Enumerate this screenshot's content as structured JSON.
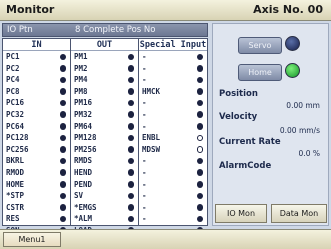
{
  "header": {
    "title": "Monitor",
    "axis_label": "Axis No. 00"
  },
  "pin_header": {
    "pin_label": "IO Ptn",
    "complete_label": "8 Complete Pos No"
  },
  "columns": {
    "in": "IN",
    "out": "OUT",
    "special": "Special Input"
  },
  "in_signals": [
    "PC1",
    "PC2",
    "PC4",
    "PC8",
    "PC16",
    "PC32",
    "PC64",
    "PC128",
    "PC256",
    "BKRL",
    "RMOD",
    "HOME",
    "*STP",
    "CSTR",
    "RES",
    "SON"
  ],
  "out_signals": [
    "PM1",
    "PM2",
    "PM4",
    "PM8",
    "PM16",
    "PM32",
    "PM64",
    "PM128",
    "PM256",
    "RMDS",
    "HEND",
    "PEND",
    "SV",
    "*EMGS",
    "*ALM",
    "LOAD"
  ],
  "special_signals": [
    "-",
    "-",
    "-",
    "HMCK",
    "-",
    "-",
    "-",
    "ENBL",
    "MDSW",
    "-",
    "-",
    "-",
    "-",
    "-",
    "-",
    "-"
  ],
  "special_dot_style": [
    "solid",
    "solid",
    "solid",
    "solid",
    "solid",
    "solid",
    "solid",
    "ring",
    "ring",
    "solid",
    "solid",
    "solid",
    "solid",
    "solid",
    "solid",
    "solid"
  ],
  "status": {
    "servo_label": "Servo",
    "home_label": "Home",
    "servo_led_color": "#1c2a5c",
    "home_led_color": "#1fbf33"
  },
  "readouts": {
    "position_label": "Position",
    "position_value": "0.00 mm",
    "velocity_label": "Velocity",
    "velocity_value": "0.00 mm/s",
    "current_label": "Current Rate",
    "current_value": "0.0 %",
    "alarm_label": "AlarmCode",
    "alarm_value": ""
  },
  "buttons": {
    "io_mon": "IO Mon",
    "data_mon": "Data Mon",
    "menu": "Menu1"
  }
}
